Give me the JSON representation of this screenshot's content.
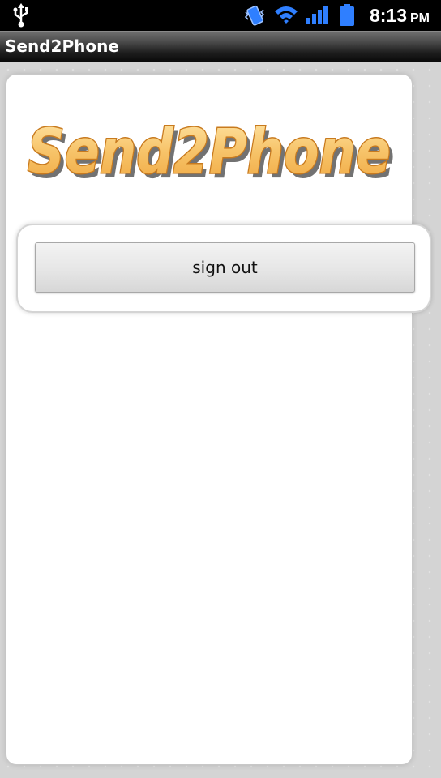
{
  "status_bar": {
    "time": "8:13",
    "ampm": "PM",
    "icons": [
      "usb-icon",
      "vibrate-icon",
      "wifi-icon",
      "signal-icon",
      "battery-icon"
    ]
  },
  "app": {
    "title": "Send2Phone",
    "logo_text": "Send2Phone"
  },
  "main": {
    "sign_out_label": "sign out"
  },
  "colors": {
    "logo_fill": "#f7c46a",
    "logo_outline": "#c87a1e",
    "status_icon_blue": "#2f7fff"
  }
}
